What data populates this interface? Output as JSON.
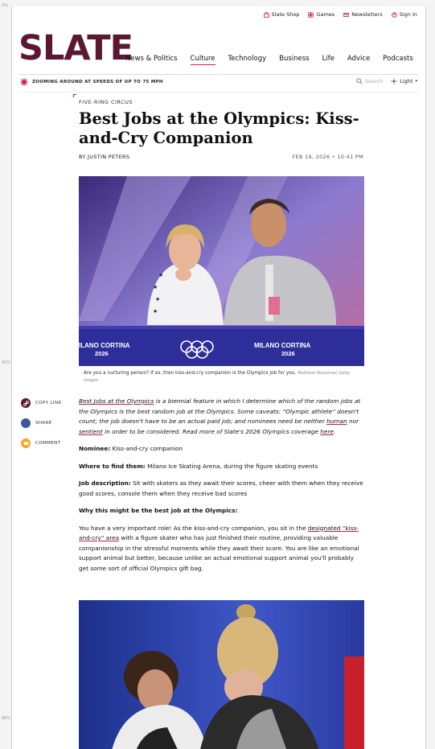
{
  "ruler": {
    "top": "0%",
    "mid": "50%",
    "bottom": "88%"
  },
  "top_links": [
    {
      "label": "Slate Shop",
      "icon": "shop-icon"
    },
    {
      "label": "Games",
      "icon": "games-icon"
    },
    {
      "label": "Newsletters",
      "icon": "mail-icon"
    },
    {
      "label": "Sign In",
      "icon": "user-icon"
    }
  ],
  "logo": "SLATE",
  "nav": [
    "News & Politics",
    "Culture",
    "Technology",
    "Business",
    "Life",
    "Advice",
    "Podcasts"
  ],
  "ticker": "ZOOMING AROUND AT SPEEDS OF UP TO 75 MPH",
  "search_label": "Search",
  "theme_label": "Light",
  "kicker": "FIVE-RING CIRCUS",
  "title": "Best Jobs at the Olympics: Kiss-and-Cry Companion",
  "byline": "BY JUSTIN PETERS",
  "date": "FEB 19, 2026 • 10:41 PM",
  "hero": {
    "banner_left": "ILANO CORTINA",
    "banner_left_year": "2026",
    "banner_right": "MILANO CORTINA",
    "banner_right_year": "2026"
  },
  "caption": "Are you a nurturing person? If so, then kiss-and-cry companion is the Olympics job for you.",
  "credit": "Matthew Stockman/ Getty Images",
  "share": {
    "copy": "COPY LINK",
    "share": "SHARE",
    "comment": "COMMENT"
  },
  "intro": {
    "link1": "Best Jobs at the Olympics",
    "t1": " is a biennial feature in which I determine which of the random jobs at the Olympics is the best random job at the Olympics. Some caveats: “Olympic athlete” doesn't count; the job doesn't have to be an actual paid job; and nominees need be neither ",
    "link2": "human",
    "t2": " nor ",
    "link3": "sentient",
    "t3": " in order to be considered. Read more of Slate's 2026 Olympics coverage ",
    "link4": "here",
    "t4": "."
  },
  "nominee": {
    "label": "Nominee:",
    "value": " Kiss-and-cry companion"
  },
  "where": {
    "label": "Where to find them:",
    "value": " Milano Ice Skating Arena, during the figure skating events"
  },
  "jobdesc": {
    "label": "Job description:",
    "value": " Sit with skaters as they await their scores, cheer with them when they receive good scores, console them when they receive bad scores"
  },
  "why": "Why this might be the best job at the Olympics:",
  "para": {
    "t1": "You have a very important role! As the kiss-and-cry companion, you sit in the ",
    "link": "designated “kiss-and-cry” area",
    "t2": " with a figure skater who has just finished their routine, providing valuable companionship in the stressful moments while they await their score. You are like an emotional support animal but better, because unlike an actual emotional support animal you'll probably get some sort of official Olympics gift bag."
  },
  "colors": {
    "brand": "#5b1830",
    "accent": "#c9184a"
  }
}
